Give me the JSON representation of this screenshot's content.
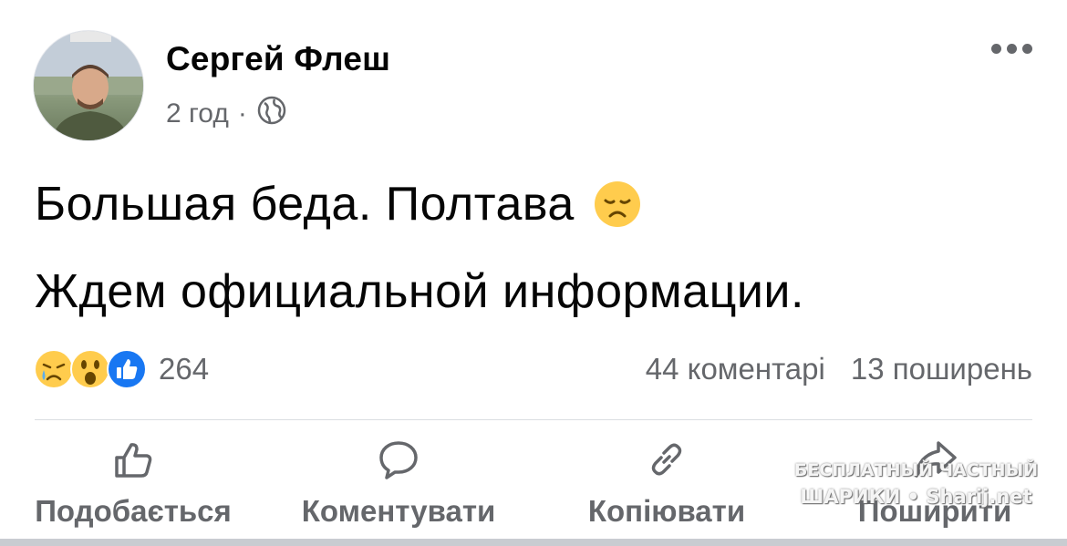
{
  "post": {
    "author": "Сергей Флеш",
    "time": "2 год",
    "separator": "·",
    "privacy_icon": "globe-icon",
    "lines": [
      "Большая беда. Полтава",
      "Ждем официальной информации."
    ],
    "emoji": "disappointed-face-emoji"
  },
  "reactions": {
    "icons": [
      "crying-face-reaction",
      "wow-reaction",
      "like-reaction"
    ],
    "count": "264"
  },
  "stats": {
    "comments": "44 коментарі",
    "shares": "13 поширень"
  },
  "actions": {
    "like": "Подобається",
    "comment": "Коментувати",
    "copy": "Копіювати",
    "share": "Поширити"
  },
  "watermark": {
    "line1": "БЕСПЛАТНЫЙ ЧАСТНЫЙ",
    "line2": "ШАРИКИ • Sharij.net"
  },
  "colors": {
    "text": "#050505",
    "secondary": "#65676b",
    "like_blue": "#1877f2",
    "emoji_yellow": "#ffcc4d"
  }
}
